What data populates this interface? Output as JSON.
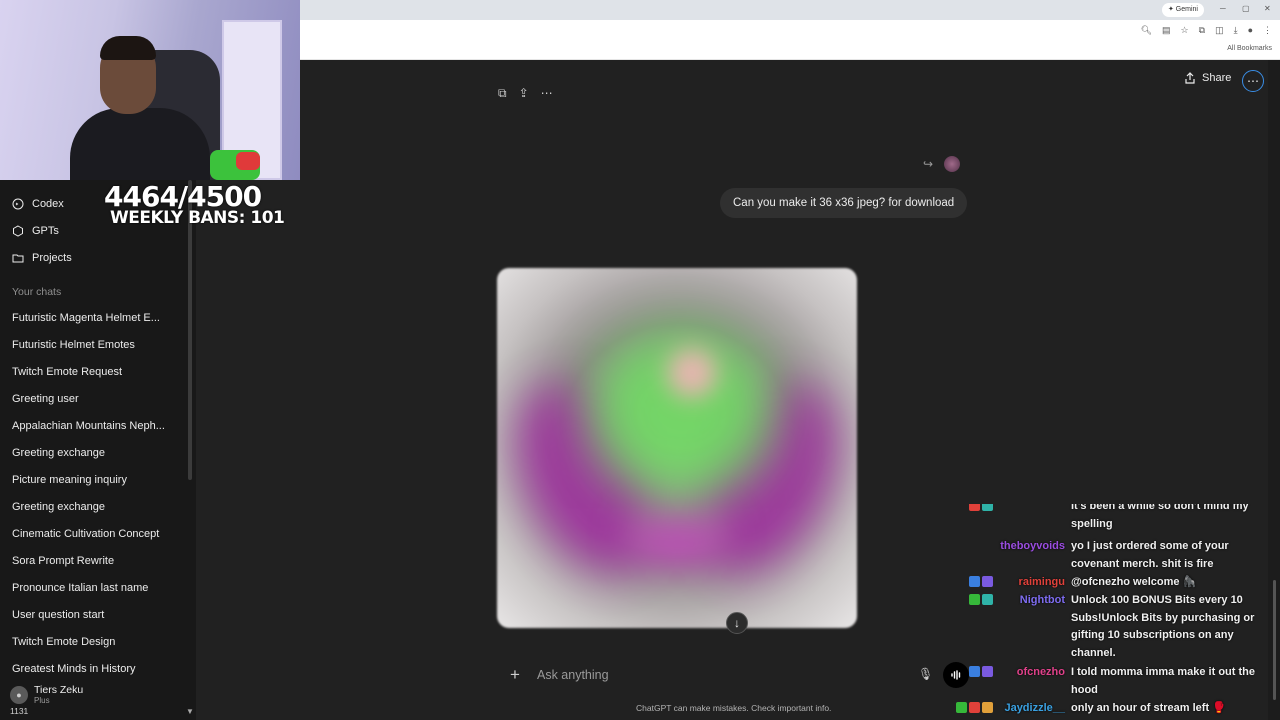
{
  "browser": {
    "gemini_label": "✦ Gemini",
    "bookmarks_label": "All Bookmarks"
  },
  "stream": {
    "counter": "4464/4500",
    "weekly_bans": "WEEKLY BANS: 101",
    "viewer_count": "1131"
  },
  "sidebar": {
    "nav": [
      {
        "label": "Codex",
        "icon": "codex-icon"
      },
      {
        "label": "GPTs",
        "icon": "gpts-icon"
      },
      {
        "label": "Projects",
        "icon": "projects-icon"
      }
    ],
    "section_title": "Your chats",
    "chats": [
      "Futuristic Magenta Helmet E...",
      "Futuristic Helmet Emotes",
      "Twitch Emote Request",
      "Greeting user",
      "Appalachian Mountains Neph...",
      "Greeting exchange",
      "Picture meaning inquiry",
      "Greeting exchange",
      "Cinematic Cultivation Concept",
      "Sora Prompt Rewrite",
      "Pronounce Italian last name",
      "User question start",
      "Twitch Emote Design",
      "Greatest Minds in History"
    ],
    "user": {
      "name": "Tiers Zeku",
      "plan": "Plus"
    }
  },
  "header": {
    "share_label": "Share",
    "more_icon": "ellipsis-icon"
  },
  "conversation": {
    "user_message": "Can you make it 36 x36 jpeg? for download",
    "image_alt": "generated magenta helmet emote (blurred)"
  },
  "composer": {
    "placeholder": "Ask anything",
    "disclaimer": "ChatGPT can make mistakes. Check important info."
  },
  "chat_overlay": {
    "messages": [
      {
        "user": "",
        "color": "#e0413a",
        "text": "It's been a while so don't mind my spelling",
        "badges": [
          "#e0413a",
          "#2fb3a8"
        ]
      },
      {
        "user": "theboyvoids",
        "color": "#9a4de0",
        "text": "yo I just ordered some of your covenant merch. shit is fire",
        "badges": []
      },
      {
        "user": "raimingu",
        "color": "#e0413a",
        "text": "@ofcnezho welcome 🦍",
        "badges": [
          "#3a7fe0",
          "#7a5ae0"
        ]
      },
      {
        "user": "Nightbot",
        "color": "#7e6cf0",
        "text": "Unlock 100 BONUS Bits every 10 Subs!Unlock Bits by purchasing or gifting 10 subscriptions on any channel.",
        "badges": [
          "#36b83a",
          "#2fb3a8"
        ]
      },
      {
        "user": "ofcnezho",
        "color": "#e0418a",
        "text": "I told momma imma make it out the hood",
        "badges": [
          "#3a7fe0",
          "#7a5ae0"
        ]
      },
      {
        "user": "Jaydizzle__",
        "color": "#3aa0e0",
        "text": "only an hour of stream left 🥊",
        "badges": [
          "#36b83a",
          "#e0413a",
          "#e0a03a"
        ]
      }
    ]
  }
}
